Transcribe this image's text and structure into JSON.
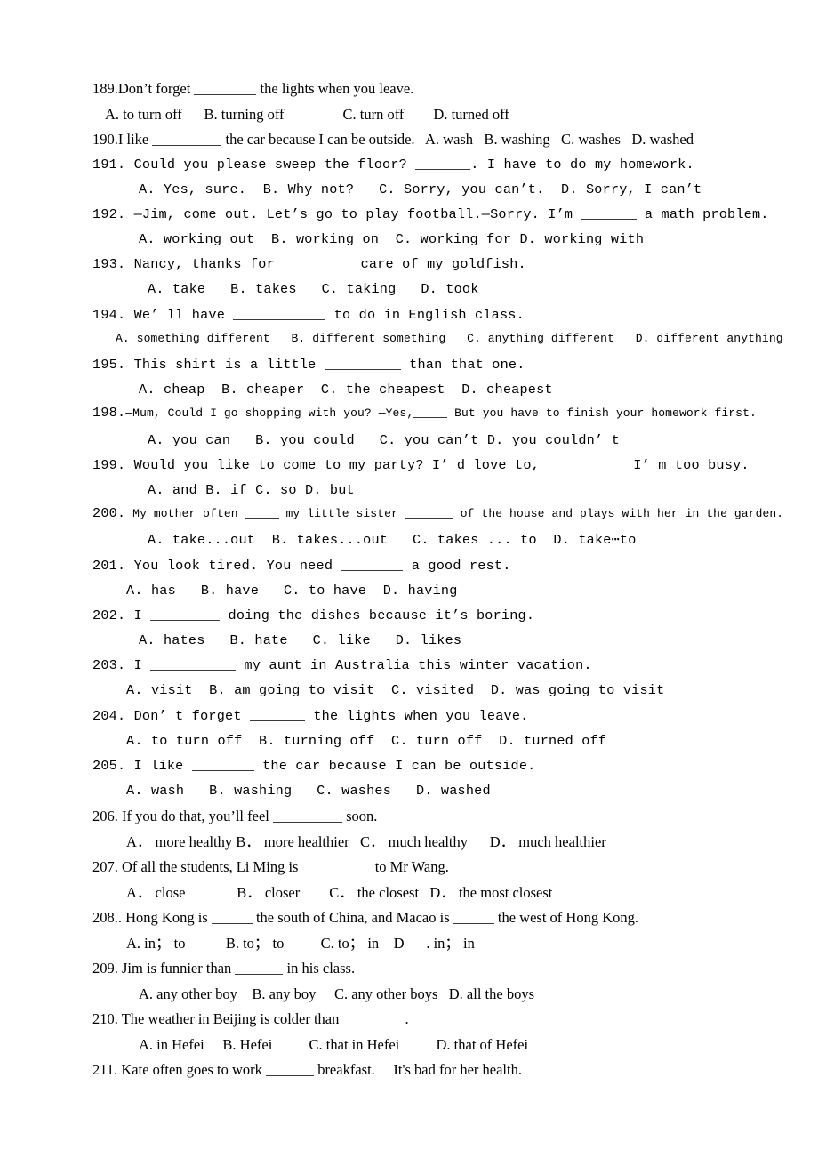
{
  "document": {
    "type": "english-grammar-multiple-choice-worksheet",
    "page_background": "#ffffff",
    "text_color": "#000000",
    "first_question_number": 189,
    "last_question_number": 211,
    "questions": [
      {
        "number": "189.",
        "stem_before": "Don’t forget ",
        "stem_after": " the lights when you leave.",
        "options_line": "A. to turn off      B. turning off                C. turn off        D. turned off"
      },
      {
        "number": "190.",
        "stem_before": "I like ",
        "stem_after": " the car because I can be outside.   A. wash   B. washing   C. washes   D. washed"
      },
      {
        "number": "191.",
        "stem_before": "Could you please sweep the floor? ",
        "stem_after": ". I have to do my homework.",
        "options_line": "A. Yes, sure.  B. Why not?   C. Sorry, you can’t.  D. Sorry, I can’t"
      },
      {
        "number": "192.",
        "stem_before": "—Jim, come out. Let’s go to play football.—Sorry. I’m ",
        "stem_after": " a math problem.",
        "options_line": "A. working out  B. working on  C. working for D. working with"
      },
      {
        "number": "193.",
        "stem_before": "Nancy, thanks for ",
        "stem_after": " care of my goldfish.",
        "options_line": "A. take   B. takes   C. taking   D. took"
      },
      {
        "number": "194.",
        "stem_before": "We’ ll have ",
        "stem_after": " to do in English class.",
        "options_line": "A. something different   B. different something   C. anything different   D. different anything"
      },
      {
        "number": "195.",
        "stem_before": "This shirt is a little ",
        "stem_after": " than that one.",
        "options_line": "A. cheap  B. cheaper  C. the cheapest  D. cheapest"
      },
      {
        "number": "198.",
        "stem_before": "—Mum, Could I go shopping with you? —Yes,",
        "stem_after": " But you have to finish your homework first.",
        "options_line": "A. you can   B. you could   C. you can’t D. you couldn’ t"
      },
      {
        "number": "199.",
        "stem_before": "Would you like to come to my party? I’ d love to, ",
        "stem_after": "I’ m too busy.",
        "options_line": "A. and B. if C. so D. but"
      },
      {
        "number": "200.",
        "stem_before": "My mother often ",
        "stem_mid": " my little sister ",
        "stem_after": " of the house and plays with her in the garden.",
        "options_line": "A. take...out  B. takes...out   C. takes ... to  D. take⋯to"
      },
      {
        "number": "201.",
        "stem_before": "You look tired. You need ",
        "stem_after": " a good rest.",
        "options_line": "A. has   B. have   C. to have  D. having"
      },
      {
        "number": "202.",
        "stem_before": "I ",
        "stem_after": " doing the dishes because it’s boring.",
        "options_line": "A. hates   B. hate   C. like   D. likes"
      },
      {
        "number": "203.",
        "stem_before": "I ",
        "stem_after": " my aunt in Australia this winter vacation.",
        "options_line": "A. visit  B. am going to visit  C. visited  D. was going to visit"
      },
      {
        "number": "204.",
        "stem_before": "Don’ t forget ",
        "stem_after": " the lights when you leave.",
        "options_line": "A. to turn off  B. turning off  C. turn off  D. turned off"
      },
      {
        "number": "205.",
        "stem_before": "I like ",
        "stem_after": " the car because I can be outside.",
        "options_line": "A. wash   B. washing   C. washes   D. washed"
      },
      {
        "number": "206.",
        "stem_before": "If you do that, you’ll feel ",
        "stem_after": " soon.",
        "options_line": "A． more healthy B． more healthier   C． much healthy      D． much healthier"
      },
      {
        "number": "207.",
        "stem_before": "Of all the students, Li Ming is ",
        "stem_after": " to Mr Wang.",
        "options_line": "A． close              B． closer        C． the closest   D． the most closest"
      },
      {
        "number": "208..",
        "stem_before": "Hong Kong is ",
        "stem_mid": " the south of China, and Macao is ",
        "stem_after": " the west of Hong Kong.",
        "options_line": "A. in； to           B. to； to          C. to； in    D      . in； in"
      },
      {
        "number": "209.",
        "stem_before": "Jim is funnier than ",
        "stem_after": " in his class.",
        "options_line": "A. any other boy    B. any boy     C. any other boys   D. all the boys"
      },
      {
        "number": "210.",
        "stem_before": "The weather in Beijing is colder than ",
        "stem_after": ".",
        "options_line": "A. in Hefei     B. Hefei          C. that in Hefei          D. that of Hefei"
      },
      {
        "number": "211.",
        "stem_before": "Kate often goes to work ",
        "stem_after": " breakfast.     It's bad for her health."
      }
    ]
  }
}
